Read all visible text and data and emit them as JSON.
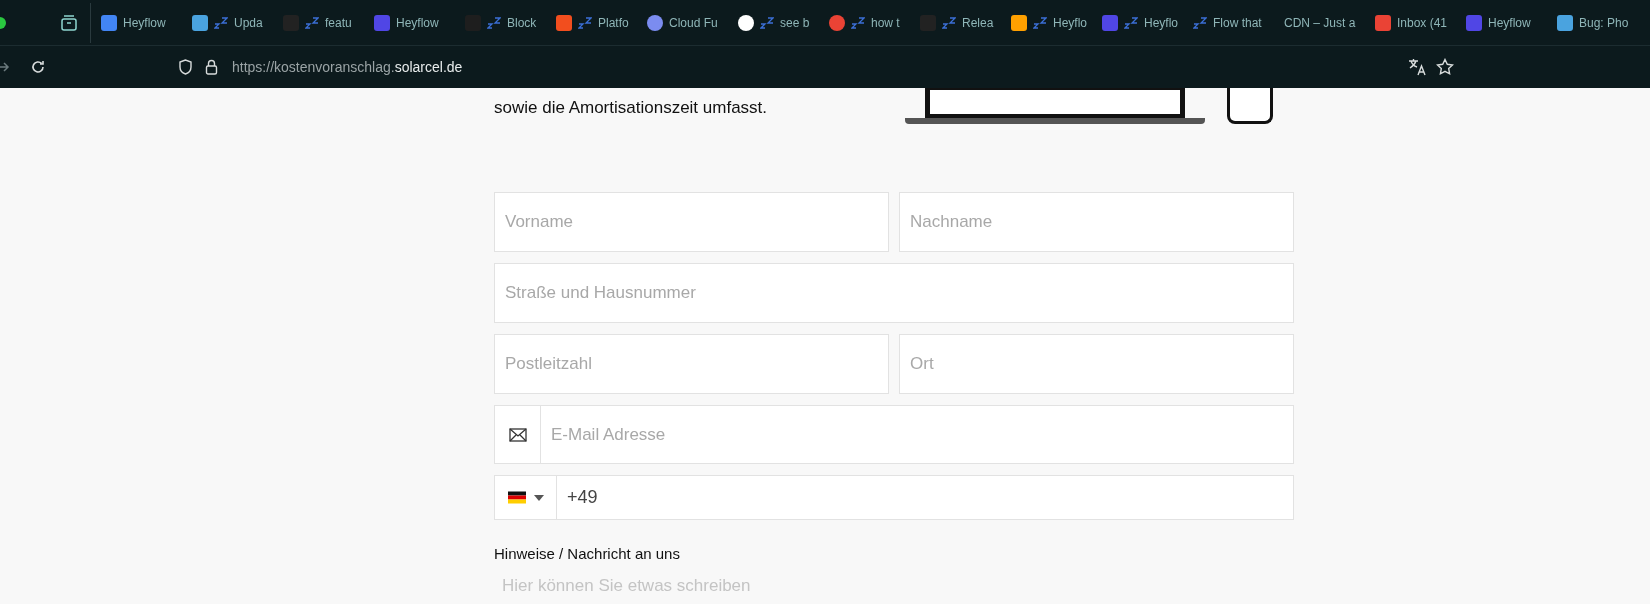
{
  "browser": {
    "tabs": [
      {
        "kind": "calendar",
        "label": "Heyflow",
        "sleeping": false
      },
      {
        "kind": "stripe",
        "label": "Upda",
        "sleeping": true
      },
      {
        "kind": "github",
        "label": "featu",
        "sleeping": true
      },
      {
        "kind": "heyflow",
        "label": "Heyflow",
        "sleeping": false
      },
      {
        "kind": "figma",
        "label": "Block",
        "sleeping": true
      },
      {
        "kind": "square",
        "label": "Platfo",
        "sleeping": true
      },
      {
        "kind": "cloud",
        "label": "Cloud Fu",
        "sleeping": false
      },
      {
        "kind": "google",
        "label": "see b",
        "sleeping": true
      },
      {
        "kind": "gcloud",
        "label": "how t",
        "sleeping": true
      },
      {
        "kind": "github",
        "label": "Relea",
        "sleeping": true
      },
      {
        "kind": "firebase",
        "label": "Heyflo",
        "sleeping": true
      },
      {
        "kind": "heyflow",
        "label": "Heyflo",
        "sleeping": true
      },
      {
        "kind": "none",
        "label": "Flow that",
        "sleeping": true
      },
      {
        "kind": "none",
        "label": "CDN – Just a",
        "sleeping": false
      },
      {
        "kind": "gmail",
        "label": "Inbox (41",
        "sleeping": false
      },
      {
        "kind": "heyflow",
        "label": "Heyflow",
        "sleeping": false
      },
      {
        "kind": "stripe",
        "label": "Bug: Pho",
        "sleeping": false
      }
    ],
    "url": {
      "base": "https://kostenvoranschlag.",
      "domain": "solarcel.de"
    }
  },
  "intro": {
    "text": "sowie die Amortisationszeit umfasst."
  },
  "form": {
    "rows": [
      [
        {
          "placeholder": "Vorname"
        },
        {
          "placeholder": "Nachname"
        }
      ],
      [
        {
          "placeholder": "Straße und Hausnummer"
        }
      ],
      [
        {
          "placeholder": "Postleitzahl"
        },
        {
          "placeholder": "Ort"
        }
      ]
    ],
    "email": {
      "placeholder": "E-Mail Adresse"
    },
    "phone": {
      "value": "+49"
    },
    "message": {
      "label": "Hinweise / Nachricht an uns",
      "placeholder": "Hier können Sie etwas schreiben"
    }
  }
}
